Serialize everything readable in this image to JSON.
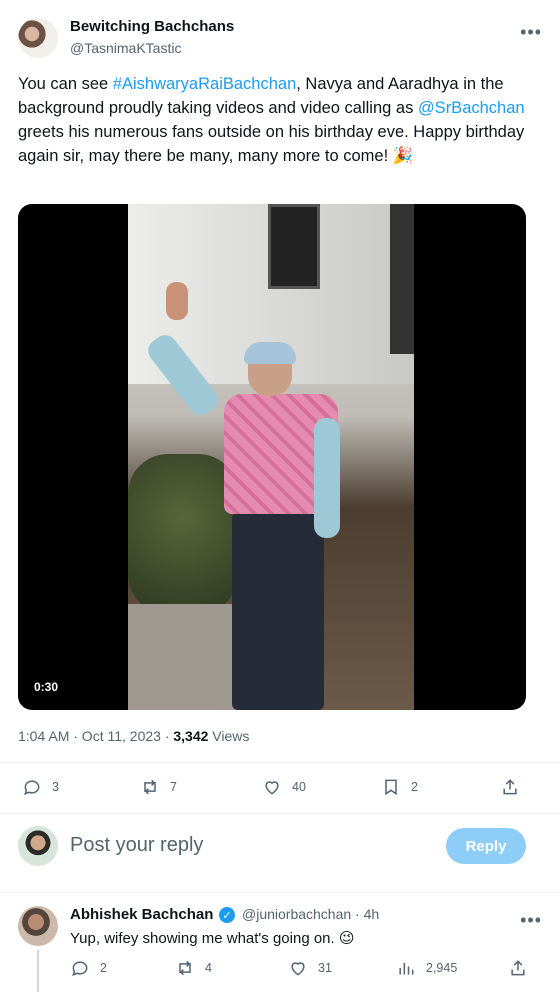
{
  "post": {
    "author_name": "Bewitching Bachchans",
    "author_handle": "@TasnimaKTastic",
    "text_prefix": "You can see ",
    "hashtag": "#AishwaryaRaiBachchan",
    "text_mid1": ", Navya and Aaradhya in the background proudly taking videos and video calling as ",
    "mention": "@SrBachchan",
    "text_suffix": " greets his numerous fans outside on his birthday eve. Happy birthday again sir, may there be many, many more to come! 🎉",
    "video_duration": "0:30",
    "timestamp": "1:04 AM · Oct 11, 2023 · ",
    "views_count": "3,342",
    "views_label": " Views"
  },
  "actions": {
    "replies": "3",
    "reposts": "7",
    "likes": "40",
    "bookmarks": "2"
  },
  "reply_box": {
    "placeholder": "Post your reply",
    "button_label": "Reply"
  },
  "comment": {
    "author_name": "Abhishek Bachchan",
    "author_handle": "@juniorbachchan · 4h",
    "text": "Yup, wifey showing me what's going on. 😉",
    "replies": "2",
    "reposts": "4",
    "likes": "31",
    "views": "2,945"
  },
  "icons": [
    "reply-icon",
    "repost-icon",
    "like-icon",
    "bookmark-icon",
    "share-icon",
    "views-icon",
    "verified-icon",
    "more-icon"
  ],
  "colors": {
    "accent": "#1d9bf0",
    "reply_button": "#8ecdf8",
    "secondary_text": "#536471"
  }
}
